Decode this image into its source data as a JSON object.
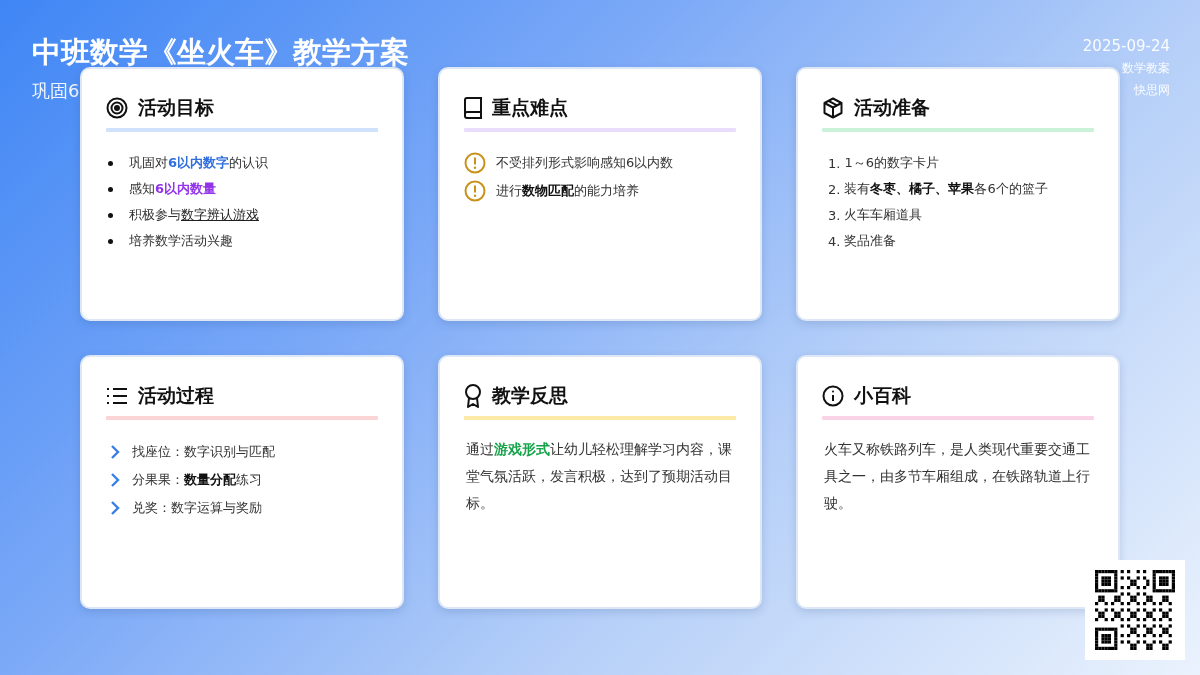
{
  "header": {
    "title": "中班数学《坐火车》教学方案",
    "subtitle": "巩固6",
    "date": "2025-09-24",
    "meta_lines": [
      "数学教案",
      "快思网"
    ]
  },
  "cards": [
    {
      "kind": "bullets",
      "title": "活动目标",
      "color": "#cfe1fb",
      "items": [
        {
          "text": "巩固对**6以内数字**的认识",
          "color": "#2f6fde"
        },
        {
          "text": "感知**6以内数量**",
          "color": "#9333ea"
        },
        {
          "text": "积极参与",
          "link": "数字辨认游戏"
        },
        {
          "text": "培养数学活动兴趣"
        }
      ]
    },
    {
      "kind": "warnings",
      "title": "重点难点",
      "color": "#eadcfb",
      "items": [
        {
          "text": "不受排列形式影响感知6以内数"
        },
        {
          "text": "进行**数物匹配**的能力培养"
        }
      ]
    },
    {
      "kind": "numbered",
      "title": "活动准备",
      "color": "#c9f2d8",
      "items": [
        {
          "number": "1.",
          "text": "1～6的数字卡片"
        },
        {
          "number": "2.",
          "text": "装有**冬枣、橘子、苹果**各6个的篮子"
        },
        {
          "number": "3.",
          "text": "火车车厢道具"
        },
        {
          "number": "4.",
          "text": "奖品准备"
        }
      ]
    },
    {
      "kind": "steps",
      "title": "活动过程",
      "color": "#fbd5d5",
      "items": [
        {
          "text": "找座位：数字识别与匹配"
        },
        {
          "text": "分果果：**数量分配**练习"
        },
        {
          "text": "兑奖：数字运算与奖励"
        }
      ]
    },
    {
      "kind": "paragraph",
      "title": "教学反思",
      "color": "#fdeaa6",
      "items": [
        {
          "text": "通过**游戏形式**让幼儿轻松理解学习内容，课堂气氛活跃，发言积极，达到了预期活动目标。",
          "color": "#16a34a"
        }
      ]
    },
    {
      "kind": "paragraph",
      "title": "小百科",
      "color": "#fbd3e6",
      "items": [
        {
          "text": "火车又称铁路列车，是人类现代重要交通工具之一，由多节车厢组成，在铁路轨道上行驶。"
        }
      ]
    }
  ]
}
